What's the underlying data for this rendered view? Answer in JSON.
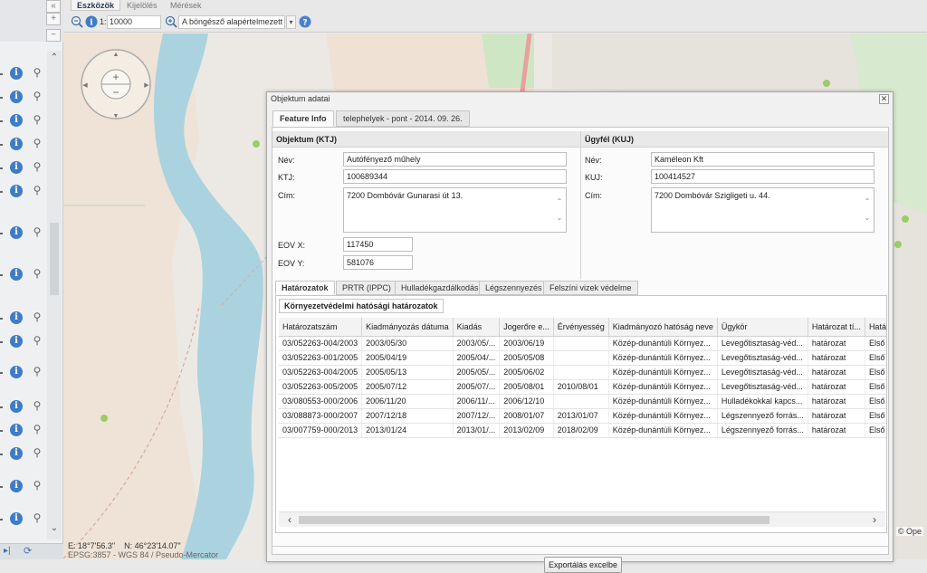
{
  "toolbar": {
    "tabs": [
      "Eszközök",
      "Kijelölés",
      "Mérések"
    ],
    "scale_prefix": "1:",
    "scale_value": "10000",
    "projection": "A böngésző alapértelmezett n"
  },
  "left_panel": {
    "rows": 18
  },
  "map": {
    "coord_e": "E: 18°7'56.3\"",
    "coord_n": "N: 46°23'14.07\"",
    "projection_text": "EPSG:3857 - WGS 84 / Pseudo-Mercator",
    "attribution": "© Ope"
  },
  "dialog": {
    "title": "Objektum adatai",
    "tabs": [
      "Feature Info",
      "telephelyek - pont - 2014. 09. 26."
    ],
    "object": {
      "heading": "Objektum (KTJ)",
      "name_label": "Név:",
      "name": "Autófényező műhely",
      "ktj_label": "KTJ:",
      "ktj": "100689344",
      "address_label": "Cím:",
      "address": "7200 Dombóvár Gunarasi út 13.",
      "eovx_label": "EOV X:",
      "eovx": "117450",
      "eovy_label": "EOV Y:",
      "eovy": "581076"
    },
    "client": {
      "heading": "Ügyfél (KUJ)",
      "name_label": "Név:",
      "name": "Kaméleon Kft",
      "kuj_label": "KUJ:",
      "kuj": "100414527",
      "address_label": "Cím:",
      "address": "7200 Dombóvár Szigligeti u. 44."
    },
    "subtabs": [
      "Határozatok",
      "PRTR (IPPC)",
      "Hulladékgazdálkodás",
      "Légszennyezés",
      "Felszíni vizek védelme"
    ],
    "inner_tab": "Környezetvédelmi hatósági határozatok",
    "columns": [
      "Határozatszám",
      "Kiadmányozás dátuma",
      "Kiadás",
      "Jogerőre e...",
      "Érvényesség",
      "Kiadmányozó hatóság neve",
      "Ügykör",
      "Határozat tí...",
      "Hatá"
    ],
    "rows": [
      [
        "03/052263-004/2003",
        "2003/05/30",
        "2003/05/...",
        "2003/06/19",
        "",
        "Közép-dunántúli Környez...",
        "Levegőtisztaság-véd...",
        "határozat",
        "Első"
      ],
      [
        "03/052263-001/2005",
        "2005/04/19",
        "2005/04/...",
        "2005/05/08",
        "",
        "Közép-dunántúli Környez...",
        "Levegőtisztaság-véd...",
        "határozat",
        "Első"
      ],
      [
        "03/052263-004/2005",
        "2005/05/13",
        "2005/05/...",
        "2005/06/02",
        "",
        "Közép-dunántúli Környez...",
        "Levegőtisztaság-véd...",
        "határozat",
        "Első"
      ],
      [
        "03/052263-005/2005",
        "2005/07/12",
        "2005/07/...",
        "2005/08/01",
        "2010/08/01",
        "Közép-dunántúli Környez...",
        "Levegőtisztaság-véd...",
        "határozat",
        "Első"
      ],
      [
        "03/080553-000/2006",
        "2006/11/20",
        "2006/11/...",
        "2006/12/10",
        "",
        "Közép-dunántúli Környez...",
        "Hulladékokkal kapcs...",
        "határozat",
        "Első"
      ],
      [
        "03/088873-000/2007",
        "2007/12/18",
        "2007/12/...",
        "2008/01/07",
        "2013/01/07",
        "Közép-dunántúli Környez...",
        "Légszennyező forrás...",
        "határozat",
        "Első"
      ],
      [
        "03/007759-000/2013",
        "2013/01/24",
        "2013/01/...",
        "2013/02/09",
        "2018/02/09",
        "Közép-dunántúli Környez...",
        "Légszennyező forrás...",
        "határozat",
        "Első"
      ]
    ],
    "export_label": "Exportálás excelbe"
  }
}
